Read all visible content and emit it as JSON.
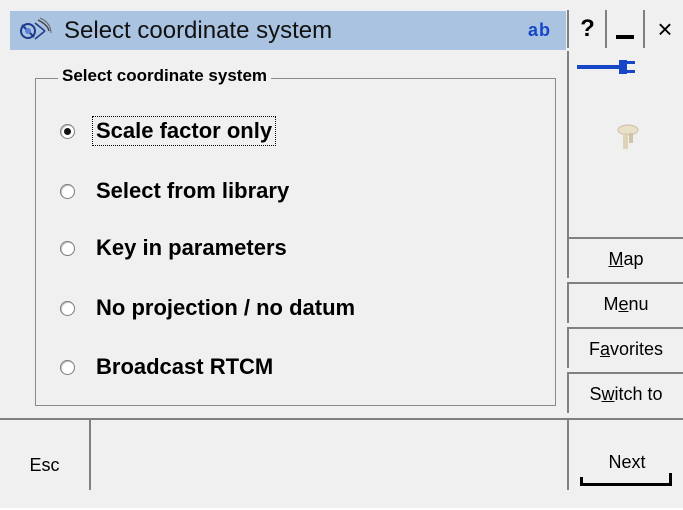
{
  "window": {
    "title": "Select coordinate system",
    "input_mode_label": "ab",
    "help_label": "?",
    "close_label": "×"
  },
  "group": {
    "legend": "Select coordinate system",
    "options": [
      {
        "label": "Scale factor only",
        "checked": true
      },
      {
        "label": "Select from library",
        "checked": false
      },
      {
        "label": "Key in parameters",
        "checked": false
      },
      {
        "label": "No projection / no datum",
        "checked": false
      },
      {
        "label": "Broadcast RTCM",
        "checked": false
      }
    ]
  },
  "side": {
    "map": {
      "pre": "",
      "ul": "M",
      "post": "ap"
    },
    "menu": {
      "pre": "M",
      "ul": "e",
      "post": "nu"
    },
    "favorites": {
      "pre": "F",
      "ul": "a",
      "post": "vorites"
    },
    "switch_to": {
      "pre": "S",
      "ul": "w",
      "post": "itch to"
    }
  },
  "bottom": {
    "esc_label": "Esc",
    "next_label": "Next"
  },
  "icons": {
    "app": "satellite-icon",
    "power": "power-plug-icon",
    "receiver": "gps-receiver-icon"
  },
  "colors": {
    "titlebar": "#a9c3e0",
    "accent_blue": "#1747c9"
  }
}
